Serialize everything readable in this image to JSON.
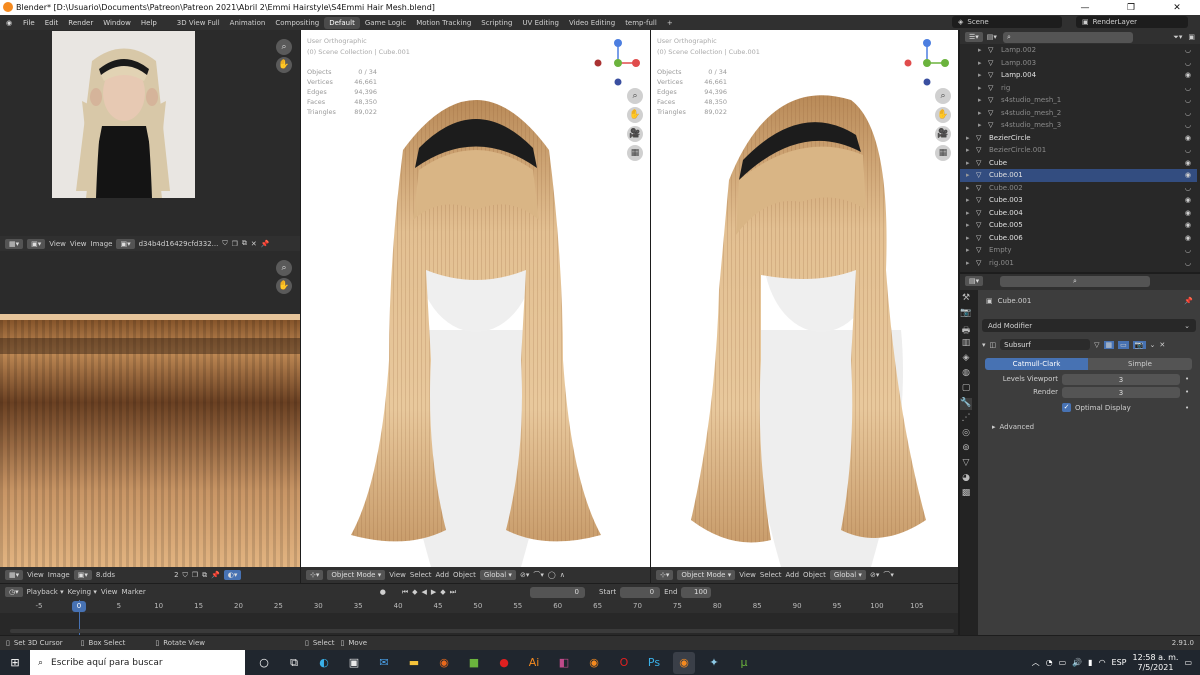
{
  "window": {
    "title": "Blender* [D:\\Usuario\\Documents\\Patreon\\Patreon 2021\\Abril 2\\Emmi Hairstyle\\S4Emmi Hair Mesh.blend]"
  },
  "menu": [
    "File",
    "Edit",
    "Render",
    "Window",
    "Help"
  ],
  "workspaces": [
    "3D View Full",
    "Animation",
    "Compositing",
    "Default",
    "Game Logic",
    "Motion Tracking",
    "Scripting",
    "UV Editing",
    "Video Editing",
    "temp-full"
  ],
  "workspace_add": "+",
  "scene": {
    "label": "Scene",
    "render_layer": "RenderLayer"
  },
  "image_editor_top": {
    "view": "View",
    "view2": "View",
    "image": "Image",
    "image_name": "d34b4d16429cfd332..."
  },
  "image_editor_bottom": {
    "view": "View",
    "image": "Image",
    "image_name": "8.dds",
    "users": "2"
  },
  "viewport_left": {
    "title": "User Orthographic",
    "collection": "(0) Scene Collection | Cube.001",
    "stats": [
      {
        "label": "Objects",
        "value": "0 / 34"
      },
      {
        "label": "Vertices",
        "value": "46,661"
      },
      {
        "label": "Edges",
        "value": "94,396"
      },
      {
        "label": "Faces",
        "value": "48,350"
      },
      {
        "label": "Triangles",
        "value": "89,022"
      }
    ]
  },
  "viewport_right": {
    "title": "User Orthographic",
    "collection": "(0) Scene Collection | Cube.001",
    "stats": [
      {
        "label": "Objects",
        "value": "0 / 34"
      },
      {
        "label": "Vertices",
        "value": "46,661"
      },
      {
        "label": "Edges",
        "value": "94,396"
      },
      {
        "label": "Faces",
        "value": "48,350"
      },
      {
        "label": "Triangles",
        "value": "89,022"
      }
    ]
  },
  "viewport_header": {
    "mode": "Object Mode",
    "view": "View",
    "select": "Select",
    "add": "Add",
    "object": "Object",
    "orientation": "Global"
  },
  "gizmo": {
    "x": "X",
    "y": "Y",
    "z": "Z",
    "x_color": "#e04c4c",
    "y_color": "#6bb33d",
    "z_color": "#4c7ee0"
  },
  "outliner": [
    {
      "name": "Lamp.002",
      "dim": true,
      "indent": 1
    },
    {
      "name": "Lamp.003",
      "dim": true,
      "indent": 1
    },
    {
      "name": "Lamp.004",
      "dim": false,
      "indent": 1
    },
    {
      "name": "rig",
      "dim": true,
      "indent": 1
    },
    {
      "name": "s4studio_mesh_1",
      "dim": true,
      "indent": 1
    },
    {
      "name": "s4studio_mesh_2",
      "dim": true,
      "indent": 1
    },
    {
      "name": "s4studio_mesh_3",
      "dim": true,
      "indent": 1
    },
    {
      "name": "BezierCircle",
      "dim": false,
      "indent": 0
    },
    {
      "name": "BezierCircle.001",
      "dim": true,
      "indent": 0
    },
    {
      "name": "Cube",
      "dim": false,
      "indent": 0
    },
    {
      "name": "Cube.001",
      "dim": false,
      "indent": 0
    },
    {
      "name": "Cube.002",
      "dim": true,
      "indent": 0
    },
    {
      "name": "Cube.003",
      "dim": false,
      "indent": 0
    },
    {
      "name": "Cube.004",
      "dim": false,
      "indent": 0
    },
    {
      "name": "Cube.005",
      "dim": false,
      "indent": 0
    },
    {
      "name": "Cube.006",
      "dim": false,
      "indent": 0
    },
    {
      "name": "Empty",
      "dim": true,
      "indent": 0
    },
    {
      "name": "rig.001",
      "dim": true,
      "indent": 0
    }
  ],
  "properties": {
    "object_name": "Cube.001",
    "add_modifier": "Add Modifier",
    "modifier_name": "Subsurf",
    "catmull": "Catmull-Clark",
    "simple": "Simple",
    "levels_label": "Levels Viewport",
    "levels_value": "3",
    "render_label": "Render",
    "render_value": "3",
    "optimal": "Optimal Display",
    "advanced": "Advanced"
  },
  "timeline": {
    "playback": "Playback",
    "keying": "Keying",
    "view": "View",
    "marker": "Marker",
    "current": "0",
    "start_label": "Start",
    "start": "0",
    "end_label": "End",
    "end": "100",
    "ruler": [
      "-5",
      "0",
      "5",
      "10",
      "15",
      "20",
      "25",
      "30",
      "35",
      "40",
      "45",
      "50",
      "55",
      "60",
      "65",
      "70",
      "75",
      "80",
      "85",
      "90",
      "95",
      "100",
      "105"
    ]
  },
  "statusbar": {
    "cursor": "Set 3D Cursor",
    "box": "Box Select",
    "rotate": "Rotate View",
    "select": "Select",
    "move": "Move",
    "version": "2.91.0"
  },
  "taskbar": {
    "search_placeholder": "Escribe aquí para buscar",
    "lang": "ESP",
    "time": "12:58 a. m.",
    "date": "7/5/2021"
  },
  "colors": {
    "accent": "#4772b3",
    "hair_light": "#e8c79a",
    "hair_dark": "#b88a57",
    "headband": "#1c1c1c"
  }
}
